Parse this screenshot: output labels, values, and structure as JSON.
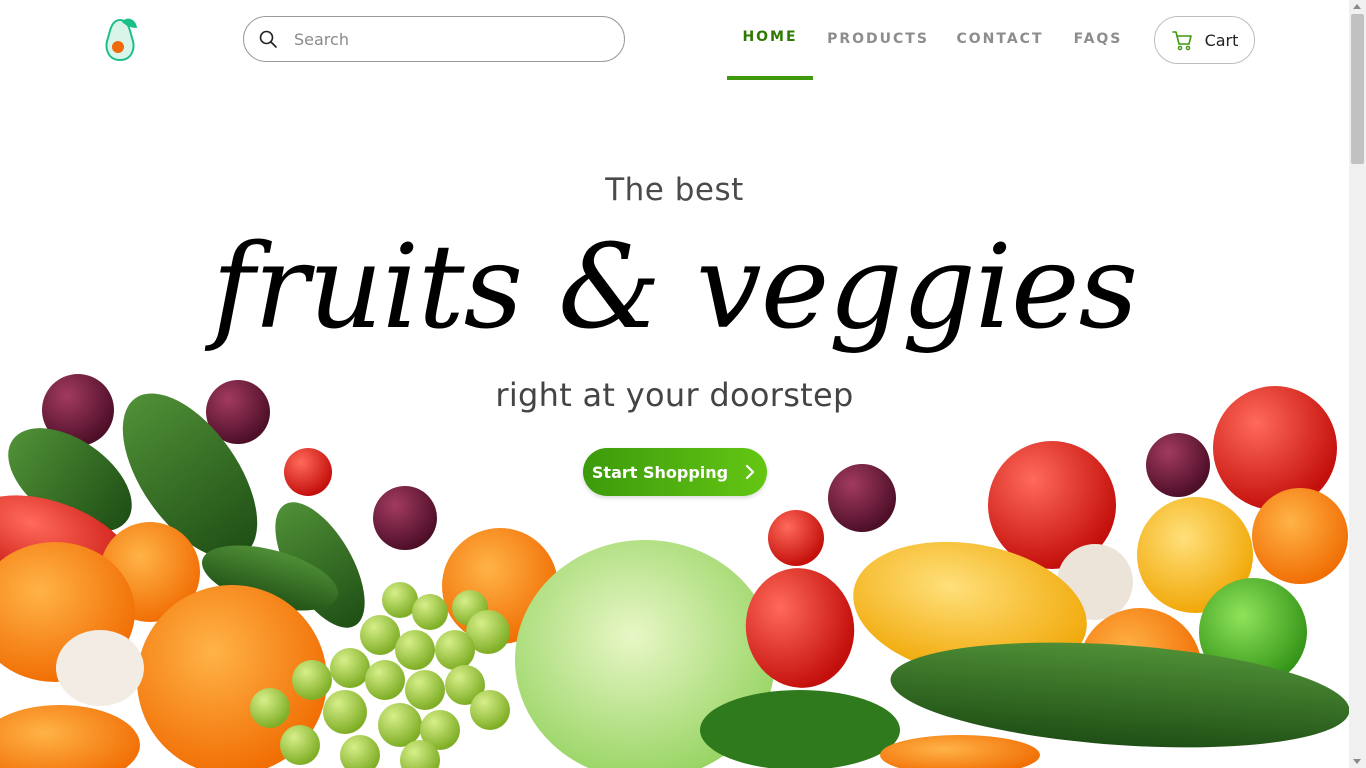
{
  "header": {
    "logo_name": "avocado-logo",
    "search": {
      "placeholder": "Search",
      "value": ""
    },
    "nav": [
      {
        "label": "HOME",
        "active": true
      },
      {
        "label": "PRODUCTS",
        "active": false
      },
      {
        "label": "CONTACT",
        "active": false
      },
      {
        "label": "FAQS",
        "active": false
      }
    ],
    "cart_label": "Cart"
  },
  "hero": {
    "pre_title": "The best",
    "title": "fruits & veggies",
    "post_title": "right at your doorstep",
    "cta_label": "Start Shopping"
  },
  "colors": {
    "accent": "#3e9a0c",
    "cta_start": "#3d9a0c",
    "cta_end": "#64c613",
    "nav_inactive": "#8d8d8d"
  },
  "icons": [
    "avocado-logo",
    "search-icon",
    "cart-icon",
    "chevron-right-icon"
  ]
}
